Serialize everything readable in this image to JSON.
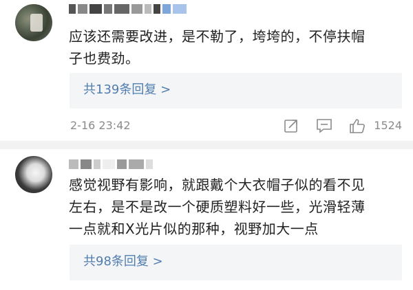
{
  "comments": [
    {
      "text_lines": [
        "应该还需要改进，是不勒了，垮垮的，不停扶帽",
        "子也费劲。"
      ],
      "reply_label": "共139条回复 >",
      "timestamp": "2-16 23:42",
      "like_count": "1524"
    },
    {
      "text_lines": [
        "感觉视野有影响，就跟戴个大衣帽子似的看不见",
        "左右，是不是改一个硬质塑料好一些，光滑轻薄",
        "一点就和X光片似的那种，视野加大一点"
      ],
      "reply_label": "共98条回复 >"
    }
  ],
  "icons": {
    "share": "share-icon",
    "comment": "comment-icon",
    "like": "thumbs-up-icon"
  },
  "colors": {
    "reply_link": "#507daf",
    "meta_gray": "#8a8a8a",
    "reply_bg": "#f4f5f7"
  }
}
